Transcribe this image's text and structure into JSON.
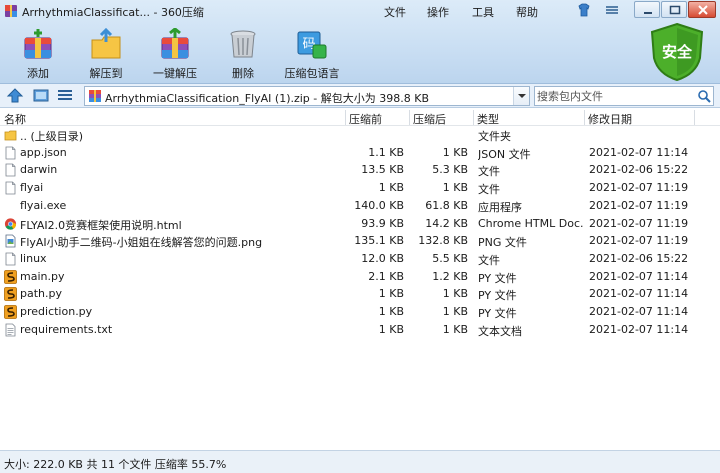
{
  "window": {
    "title": "ArrhythmiaClassificat... - 360压缩",
    "menus": [
      "文件",
      "操作",
      "工具",
      "帮助"
    ]
  },
  "toolbar": {
    "items": [
      {
        "label": "添加",
        "icon": "add-archive-icon"
      },
      {
        "label": "解压到",
        "icon": "extract-to-icon"
      },
      {
        "label": "一键解压",
        "icon": "one-click-extract-icon"
      },
      {
        "label": "删除",
        "icon": "delete-trash-icon"
      },
      {
        "label": "压缩包语言",
        "icon": "archive-language-icon"
      }
    ],
    "safe_label": "安全"
  },
  "address": {
    "path": "ArrhythmiaClassification_FlyAI (1).zip - 解包大小为 398.8 KB",
    "search_placeholder": "搜索包内文件"
  },
  "columns": {
    "name": "名称",
    "size": "压缩前",
    "packed": "压缩后",
    "type": "类型",
    "modified": "修改日期"
  },
  "files": [
    {
      "name": ".. (上级目录)",
      "size": "",
      "packed": "",
      "type": "文件夹",
      "modified": "",
      "icon": "folder-icon"
    },
    {
      "name": "app.json",
      "size": "1.1 KB",
      "packed": "1 KB",
      "type": "JSON 文件",
      "modified": "2021-02-07 11:14",
      "icon": "file-icon"
    },
    {
      "name": "darwin",
      "size": "13.5 KB",
      "packed": "5.3 KB",
      "type": "文件",
      "modified": "2021-02-06 15:22",
      "icon": "file-icon"
    },
    {
      "name": "flyai",
      "size": "1 KB",
      "packed": "1 KB",
      "type": "文件",
      "modified": "2021-02-07 11:19",
      "icon": "file-icon"
    },
    {
      "name": "flyai.exe",
      "size": "140.0 KB",
      "packed": "61.8 KB",
      "type": "应用程序",
      "modified": "2021-02-07 11:19",
      "icon": "exe-icon"
    },
    {
      "name": "FLYAI2.0竞赛框架使用说明.html",
      "size": "93.9 KB",
      "packed": "14.2 KB",
      "type": "Chrome HTML Doc...",
      "modified": "2021-02-07 11:19",
      "icon": "chrome-icon"
    },
    {
      "name": "FlyAI小助手二维码-小姐姐在线解答您的问题.png",
      "size": "135.1 KB",
      "packed": "132.8 KB",
      "type": "PNG 文件",
      "modified": "2021-02-07 11:19",
      "icon": "image-file-icon"
    },
    {
      "name": "linux",
      "size": "12.0 KB",
      "packed": "5.5 KB",
      "type": "文件",
      "modified": "2021-02-06 15:22",
      "icon": "file-icon"
    },
    {
      "name": "main.py",
      "size": "2.1 KB",
      "packed": "1.2 KB",
      "type": "PY 文件",
      "modified": "2021-02-07 11:14",
      "icon": "python-file-icon"
    },
    {
      "name": "path.py",
      "size": "1 KB",
      "packed": "1 KB",
      "type": "PY 文件",
      "modified": "2021-02-07 11:14",
      "icon": "python-file-icon"
    },
    {
      "name": "prediction.py",
      "size": "1 KB",
      "packed": "1 KB",
      "type": "PY 文件",
      "modified": "2021-02-07 11:14",
      "icon": "python-file-icon"
    },
    {
      "name": "requirements.txt",
      "size": "1 KB",
      "packed": "1 KB",
      "type": "文本文档",
      "modified": "2021-02-07 11:14",
      "icon": "text-file-icon"
    }
  ],
  "status": {
    "text": "大小: 222.0 KB 共 11 个文件 压缩率 55.7%"
  },
  "colors": {
    "header_bg": "#c9def3",
    "safe_green": "#4caf2a",
    "python_orange": "#f0a020"
  }
}
